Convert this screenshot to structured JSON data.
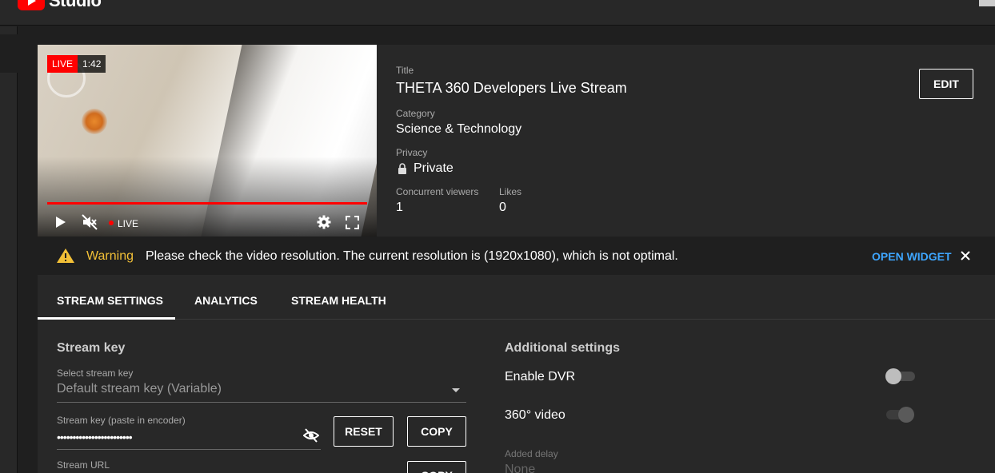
{
  "app": {
    "brand": "Studio"
  },
  "player": {
    "live_label": "LIVE",
    "elapsed": "1:42",
    "live_indicator": "LIVE"
  },
  "details": {
    "title_label": "Title",
    "title": "THETA 360 Developers Live Stream",
    "category_label": "Category",
    "category": "Science & Technology",
    "privacy_label": "Privacy",
    "privacy": "Private",
    "viewers_label": "Concurrent viewers",
    "viewers": "1",
    "likes_label": "Likes",
    "likes": "0",
    "edit_label": "EDIT"
  },
  "warning": {
    "title": "Warning",
    "message": "Please check the video resolution. The current resolution is (1920x1080), which is not optimal.",
    "action": "OPEN WIDGET"
  },
  "tabs": [
    {
      "label": "STREAM SETTINGS",
      "active": true
    },
    {
      "label": "ANALYTICS",
      "active": false
    },
    {
      "label": "STREAM HEALTH",
      "active": false
    }
  ],
  "stream_key": {
    "section_title": "Stream key",
    "select_label": "Select stream key",
    "select_value": "Default stream key (Variable)",
    "key_label": "Stream key (paste in encoder)",
    "key_value": "••••••••••••••••••••••••",
    "reset_label": "RESET",
    "copy_label": "COPY",
    "url_label": "Stream URL",
    "url_copy_label": "COPY"
  },
  "additional": {
    "section_title": "Additional settings",
    "dvr_label": "Enable DVR",
    "dvr_on": false,
    "video360_label": "360° video",
    "video360_on": true,
    "delay_label": "Added delay",
    "delay_value": "None"
  },
  "colors": {
    "accent": "#3ea6ff",
    "warning": "#f2c037",
    "live": "#ff0000"
  }
}
